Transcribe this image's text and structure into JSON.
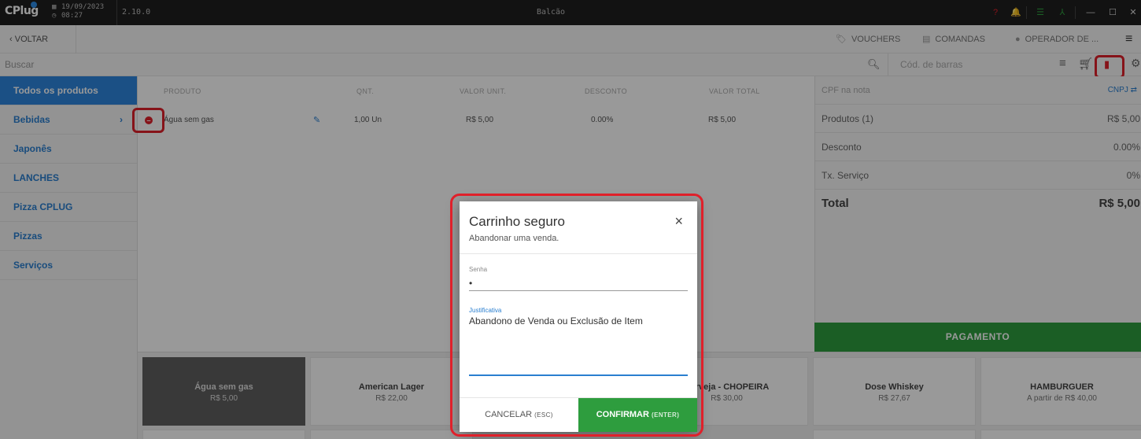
{
  "app": {
    "logo_text": "CPlug",
    "date": "19/09/2023",
    "time": "08:27",
    "version": "2.10.0",
    "window_title": "Balcão"
  },
  "toolbar": {
    "back_label": "VOLTAR",
    "vouchers_label": "VOUCHERS",
    "comandas_label": "COMANDAS",
    "operador_label": "OPERADOR DE ..."
  },
  "search": {
    "placeholder": "Buscar",
    "barcode_placeholder": "Cód. de barras"
  },
  "categories": [
    {
      "label": "Todos os produtos"
    },
    {
      "label": "Bebidas"
    },
    {
      "label": "Japonês"
    },
    {
      "label": "LANCHES"
    },
    {
      "label": "Pizza CPLUG"
    },
    {
      "label": "Pizzas"
    },
    {
      "label": "Serviços"
    }
  ],
  "table": {
    "headers": {
      "produto": "PRODUTO",
      "qnt": "QNT.",
      "valor_unit": "VALOR UNIT.",
      "desconto": "DESCONTO",
      "valor_total": "VALOR TOTAL"
    },
    "rows": [
      {
        "produto": "Água sem gas",
        "qnt": "1,00 Un",
        "valor_unit": "R$ 5,00",
        "desconto": "0.00%",
        "valor_total": "R$ 5,00"
      }
    ]
  },
  "summary": {
    "cpf_placeholder": "CPF na nota",
    "cnpj_label": "CNPJ",
    "produtos_label": "Produtos (1)",
    "produtos_value": "R$ 5,00",
    "desconto_label": "Desconto",
    "desconto_value": "0.00%",
    "servico_label": "Tx. Serviço",
    "servico_value": "0%",
    "total_label": "Total",
    "total_value": "R$ 5,00",
    "payment_label": "PAGAMENTO"
  },
  "products": [
    {
      "name": "Água sem gas",
      "price": "R$ 5,00"
    },
    {
      "name": "American Lager",
      "price": "R$ 22,00"
    },
    {
      "name": "",
      "price": ""
    },
    {
      "name": "Cerveja - CHOPEIRA",
      "price": "R$ 30,00"
    },
    {
      "name": "Dose Whiskey",
      "price": "R$ 27,67"
    },
    {
      "name": "HAMBURGUER",
      "price": "A partir de R$ 40,00"
    }
  ],
  "modal": {
    "title": "Carrinho seguro",
    "subtitle": "Abandonar uma venda.",
    "close_glyph": "×",
    "senha_label": "Senha",
    "senha_value": "•",
    "justificativa_label": "Justificativa",
    "justificativa_value": "Abandono de Venda ou Exclusão de Item",
    "cancel_label": "CANCELAR",
    "cancel_hint": "(ESC)",
    "confirm_label": "CONFIRMAR",
    "confirm_hint": "(ENTER)"
  },
  "colors": {
    "accent": "#2e86de",
    "success": "#2e9d3e",
    "danger": "#e0202a"
  }
}
